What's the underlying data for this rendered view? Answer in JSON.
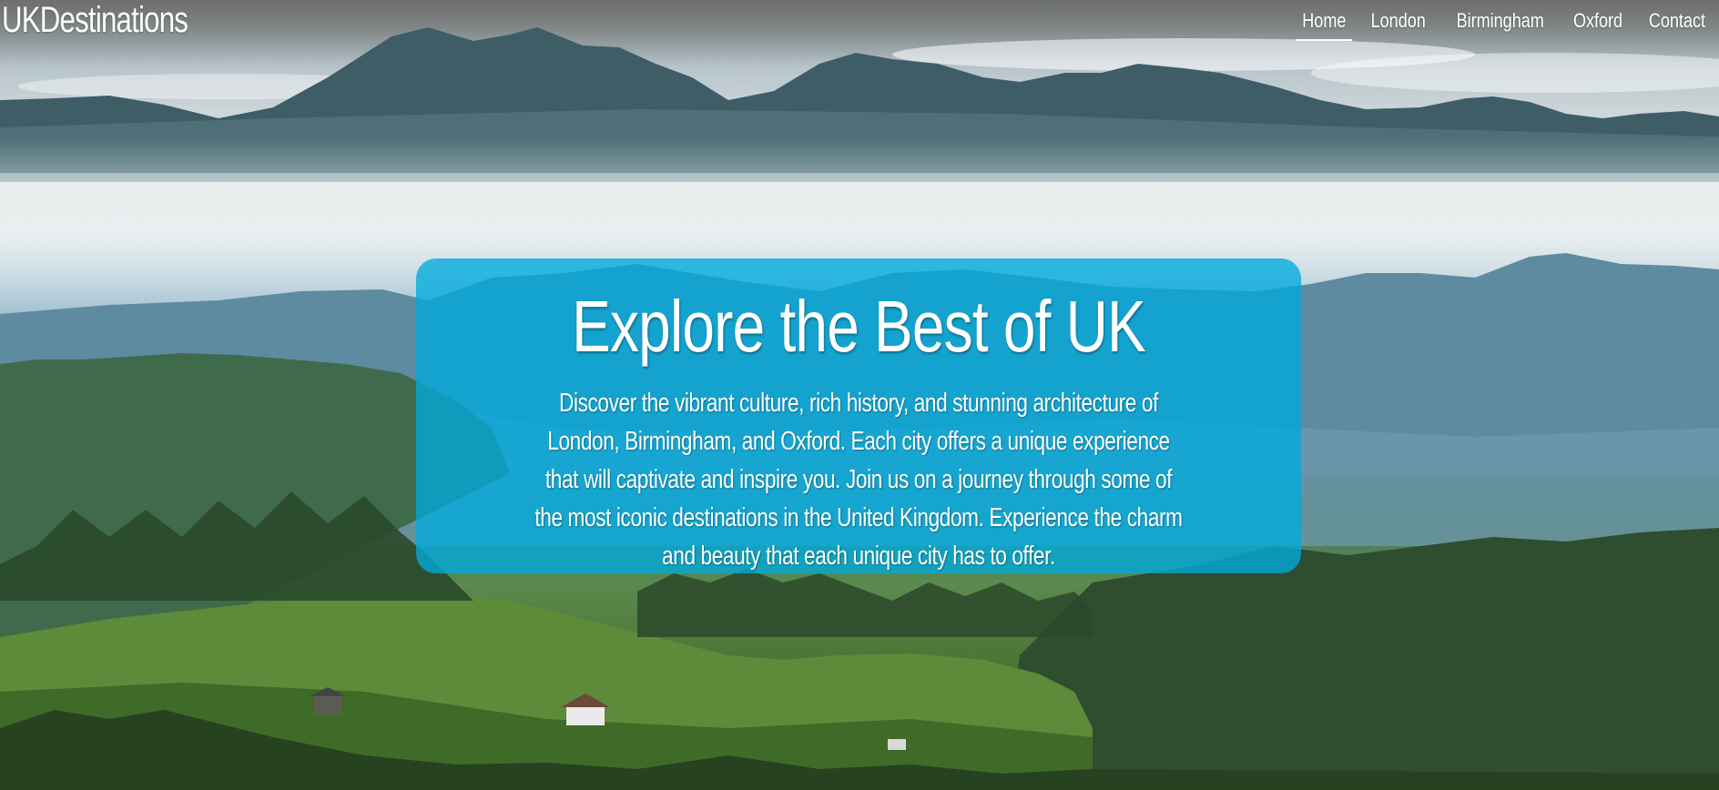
{
  "brand": {
    "title": "UKDestinations"
  },
  "nav": {
    "items": [
      {
        "label": "Home",
        "active": true
      },
      {
        "label": "London"
      },
      {
        "label": "Birmingham"
      },
      {
        "label": "Oxford"
      },
      {
        "label": "Contact"
      }
    ]
  },
  "hero": {
    "title": "Explore the Best of UK",
    "text": "Discover the vibrant culture, rich history, and stunning architecture of London, Birmingham, and Oxford. Each city offers a unique experience that will captivate and inspire you. Join us on a journey through some of the most iconic destinations in the United Kingdom. Experience the charm and beauty that each unique city has to offer.",
    "background_image": "misty-mountain-valley-landscape"
  },
  "colors": {
    "card_background": "#0ab4e6",
    "text": "#ffffff"
  }
}
